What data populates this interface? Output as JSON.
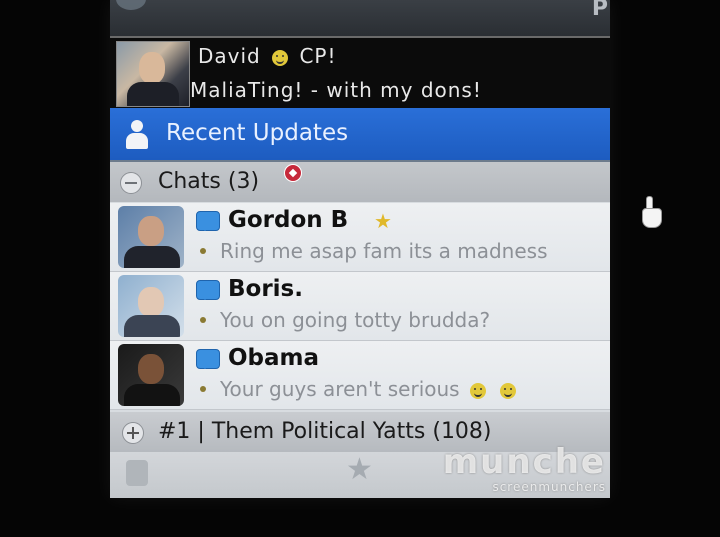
{
  "profile": {
    "name_first": "David",
    "name_rest": "CP!",
    "status": "MaliaTing! - with my dons!"
  },
  "recent_updates": {
    "label": "Recent Updates"
  },
  "chats": {
    "header_label": "Chats (3)",
    "items": [
      {
        "name": "Gordon B",
        "message": "Ring me asap fam its a madness",
        "starred": true
      },
      {
        "name": "Boris.",
        "message": "You on going totty brudda?",
        "starred": false
      },
      {
        "name": "Obama",
        "message": "Your guys aren't serious",
        "starred": false
      }
    ]
  },
  "group": {
    "label": "#1 | Them Political Yatts (108)"
  },
  "watermark": {
    "line1": "munche",
    "line2": "screenmunchers"
  },
  "colors": {
    "recent_bar": "#1d5cc0",
    "profile_bg": "#0b0b0b",
    "chat_icon": "#3a90e0",
    "notification": "#c6283a",
    "star": "#e0b82a"
  },
  "icons": {
    "recent": "person-icon",
    "chat": "chat-bubble-icon",
    "notification": "notification-icon",
    "star": "star-icon",
    "collapse": "collapse-icon",
    "expand": "expand-icon",
    "cursor": "hand-cursor-icon"
  }
}
